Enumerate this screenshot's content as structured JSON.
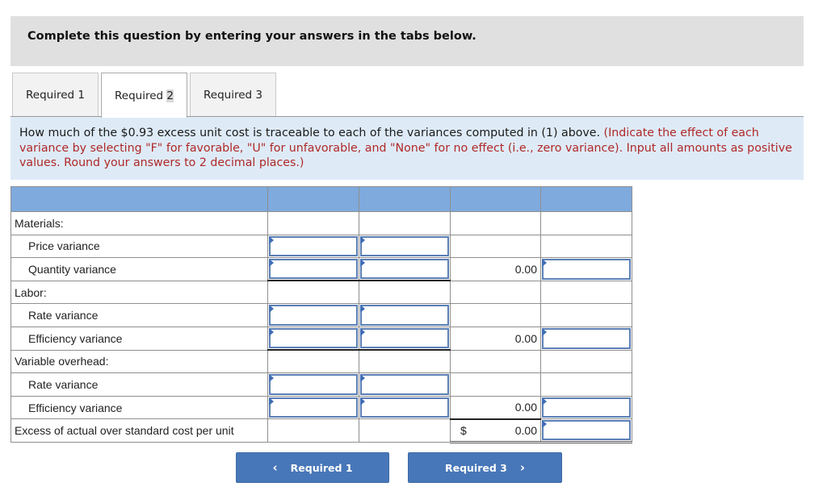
{
  "banner": {
    "text": "Complete this question by entering your answers in the tabs below."
  },
  "tabs": [
    {
      "label": "Required 1",
      "active": false
    },
    {
      "label_prefix": "Required ",
      "label_highlight": "2",
      "active": true
    },
    {
      "label": "Required 3",
      "active": false
    }
  ],
  "question": {
    "text": "How much of the $0.93 excess unit cost is traceable to each of the variances computed in (1) above.",
    "instruction": "(Indicate the effect of each variance by selecting \"F\" for favorable, \"U\" for unfavorable, and \"None\" for no effect (i.e., zero variance). Input all amounts as positive values. Round your answers to 2 decimal places.)"
  },
  "table": {
    "rows": [
      {
        "label": "Materials:"
      },
      {
        "label": "Price variance"
      },
      {
        "label": "Quantity variance",
        "subtotal": "0.00"
      },
      {
        "label": "Labor:"
      },
      {
        "label": "Rate variance"
      },
      {
        "label": "Efficiency variance",
        "subtotal": "0.00"
      },
      {
        "label": "Variable overhead:"
      },
      {
        "label": "Rate variance"
      },
      {
        "label": "Efficiency variance",
        "subtotal": "0.00"
      },
      {
        "label": "Excess of actual over standard cost per unit",
        "currency": "$",
        "total": "0.00"
      }
    ]
  },
  "nav": {
    "prev_label": "Required 1",
    "next_label": "Required 3",
    "prev_icon": "‹",
    "next_icon": "›"
  },
  "colors": {
    "header_blue": "#7faadd",
    "button_blue": "#4777b8",
    "question_bg": "#deebf7",
    "instruction_red": "#b02828"
  }
}
